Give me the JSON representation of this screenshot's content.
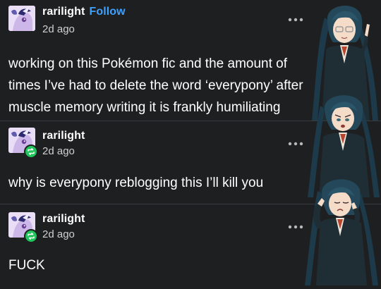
{
  "posts": [
    {
      "username": "rarilight",
      "follow_label": "Follow",
      "time": "2d ago",
      "text": "working on this Pokémon fic and the amount of times I’ve had to delete the word ‘everypony’ after muscle memory writing it is frankly humiliating"
    },
    {
      "username": "rarilight",
      "time": "2d ago",
      "text": "why is everypony reblogging this I’ll kill you"
    },
    {
      "username": "rarilight",
      "time": "2d ago",
      "text": "FUCK"
    }
  ],
  "icons": {
    "more": "more-options-icon",
    "reblog": "reblog-icon"
  },
  "colors": {
    "background": "#1e1f21",
    "follow": "#3ea1ff",
    "reblog_badge": "#20c55b"
  }
}
